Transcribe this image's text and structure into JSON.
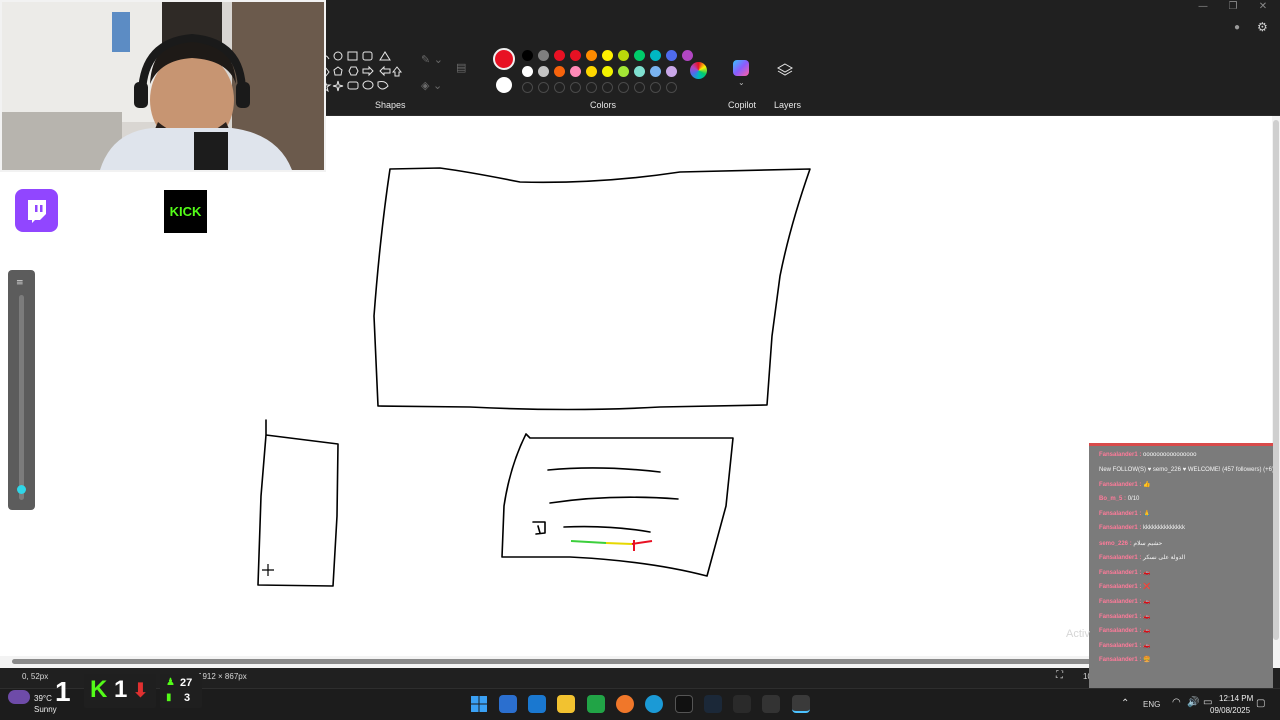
{
  "ribbon": {
    "shapes_label": "Shapes",
    "colors_label": "Colors",
    "copilot_label": "Copilot",
    "layers_label": "Layers",
    "palette_row1": [
      "#000000",
      "#7f7f7f",
      "#e81123",
      "#e81123",
      "#ff8c00",
      "#fff100",
      "#bad80a",
      "#00cc6a",
      "#00b7c3",
      "#4f6bed",
      "#b146c2"
    ],
    "palette_row2": [
      "#ffffff",
      "#c3c3c3",
      "#f7630c",
      "#ff8ab8",
      "#ffd700",
      "#f2f200",
      "#a3e635",
      "#7fe0d0",
      "#7ab3ef",
      "#c9a7e8"
    ],
    "primary_color": "#e81123",
    "secondary_color": "#ffffff"
  },
  "statusbar": {
    "cursor_pos": "0, 52px",
    "canvas_size": "1912 × 867px",
    "zoom": "100%"
  },
  "overlay": {
    "kick_label": "KICK",
    "weather_temp": "39°C",
    "weather_desc": "Sunny",
    "stat_one": "1",
    "kick_count": "1",
    "viewers_top": "27",
    "viewers_bottom": "3",
    "activate_text": "Activ"
  },
  "chat": {
    "lines": [
      {
        "user": "Fansalander1 :",
        "msg": "oooooooooooooooo"
      },
      {
        "user": "",
        "msg": "New FOLLOW(S) ♥ semo_226 ♥ WELCOME! (457 followers) (+6)"
      },
      {
        "user": "Fansalander1 :",
        "msg": "👍"
      },
      {
        "user": "Bo_m_5 :",
        "msg": "0/10"
      },
      {
        "user": "Fansalander1 :",
        "msg": "🙏"
      },
      {
        "user": "Fansalander1 :",
        "msg": "kkkkkkkkkkkkkk"
      },
      {
        "user": "semo_226 :",
        "msg": "حشيم سلام"
      },
      {
        "user": "Fansalander1 :",
        "msg": "الدولة على نسكر"
      },
      {
        "user": "Fansalander1 :",
        "msg": "🚗"
      },
      {
        "user": "Fansalander1 :",
        "msg": "❌"
      },
      {
        "user": "Fansalander1 :",
        "msg": "🚗"
      },
      {
        "user": "Fansalander1 :",
        "msg": "🚗"
      },
      {
        "user": "Fansalander1 :",
        "msg": "🚗"
      },
      {
        "user": "Fansalander1 :",
        "msg": "🚗"
      },
      {
        "user": "Fansalander1 :",
        "msg": "🍔"
      }
    ]
  },
  "tray": {
    "language": "ENG",
    "time": "12:14 PM",
    "date": "09/08/2025"
  },
  "colors": {
    "chrome": "#202020",
    "twitch": "#9146ff",
    "kick": "#53fc18",
    "accent": "#0f6cbd"
  }
}
